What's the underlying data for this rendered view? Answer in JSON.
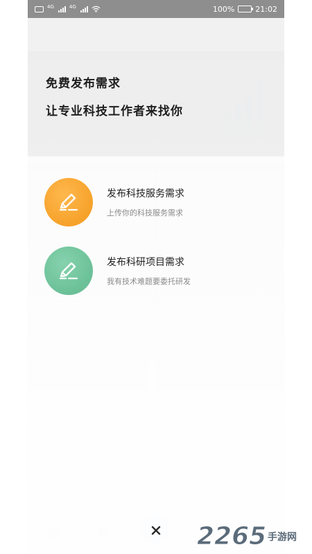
{
  "status_bar": {
    "network_tag_1": "4G",
    "network_tag_2": "4G",
    "battery_percent": "100%",
    "time": "21:02",
    "battery_level": 1.0
  },
  "overlay": {
    "headline_line1": "免费发布需求",
    "headline_line2": "让专业科技工作者来找你"
  },
  "options": [
    {
      "title": "发布科技服务需求",
      "subtitle": "上传你的科技服务需求",
      "icon": "edit-pencil-icon",
      "color": "#f7a52f"
    },
    {
      "title": "发布科研项目需求",
      "subtitle": "我有技术难题要委托研发",
      "icon": "edit-pencil-icon",
      "color": "#6fc39b"
    }
  ],
  "close": {
    "icon": "close-icon",
    "glyph": "×"
  },
  "watermark": {
    "number": "2265",
    "suffix": "手游网"
  }
}
